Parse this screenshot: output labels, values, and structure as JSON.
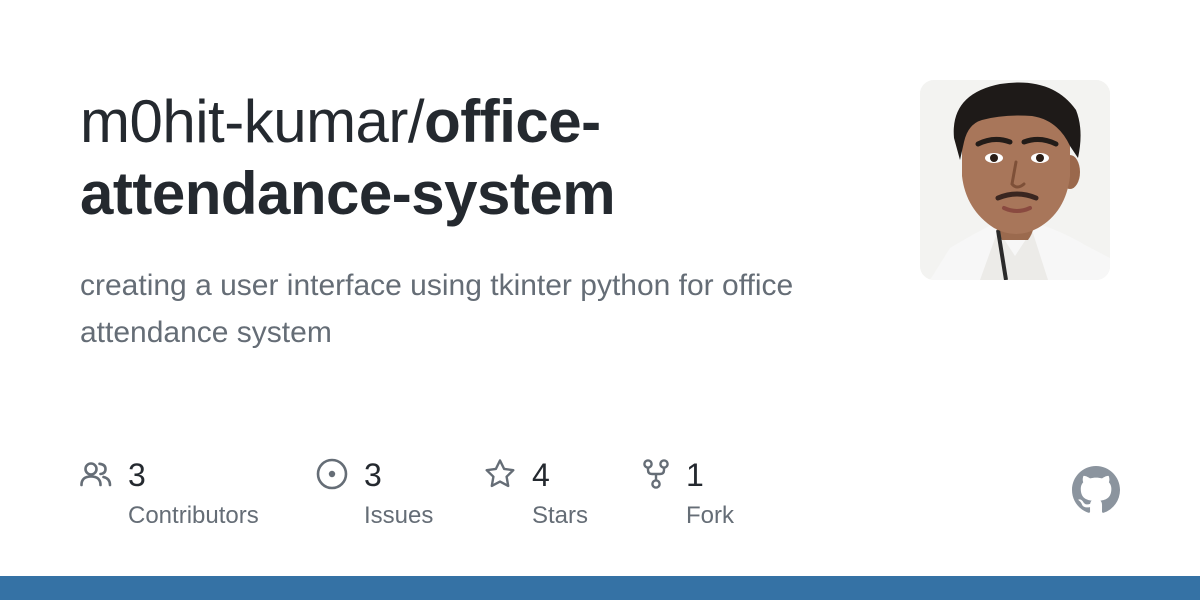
{
  "repo": {
    "owner": "m0hit-kumar/",
    "name": "office-attendance-system",
    "description": "creating a user interface using tkinter python for office attendance system"
  },
  "stats": [
    {
      "icon": "contributors-icon",
      "count": "3",
      "label": "Contributors"
    },
    {
      "icon": "issues-icon",
      "count": "3",
      "label": "Issues"
    },
    {
      "icon": "star-icon",
      "count": "4",
      "label": "Stars"
    },
    {
      "icon": "fork-icon",
      "count": "1",
      "label": "Fork"
    }
  ],
  "colors": {
    "title": "#24292f",
    "muted": "#656d76",
    "language_bar": "#3572a5",
    "icon": "#656d76"
  }
}
